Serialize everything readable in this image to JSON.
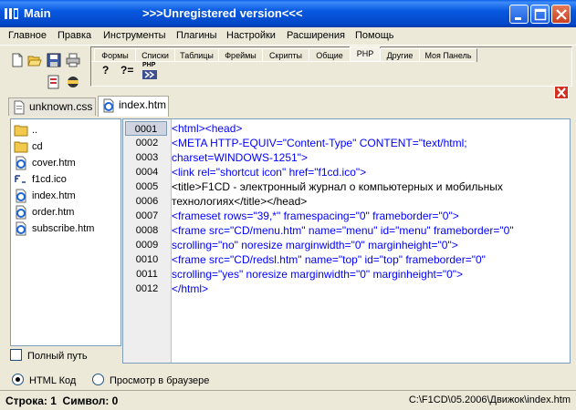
{
  "window": {
    "title": "Main",
    "subtitle": ">>>Unregistered version<<<"
  },
  "menu": [
    "Главное",
    "Правка",
    "Инструменты",
    "Плагины",
    "Настройки",
    "Расширения",
    "Помощь"
  ],
  "toolbar": {
    "icons": [
      "new-file-icon",
      "open-folder-icon",
      "save-icon",
      "print-icon",
      "preview-icon",
      "ftp-icon"
    ]
  },
  "tag_tabs": [
    "Формы",
    "Списки",
    "Таблицы",
    "Фреймы",
    "Скрипты",
    "Общие",
    "PHP",
    "Другие",
    "Моя Панель"
  ],
  "active_tag_tab": "PHP",
  "panel_buttons": [
    "?",
    "?=",
    "PHP"
  ],
  "doc_tabs": [
    {
      "label": "unknown.css",
      "active": false
    },
    {
      "label": "index.htm",
      "active": true
    }
  ],
  "files": [
    "..",
    "cd",
    "cover.htm",
    "f1cd.ico",
    "index.htm",
    "order.htm",
    "subscribe.htm"
  ],
  "full_path_label": "Полный путь",
  "line_numbers": [
    "0001",
    "0002",
    "0003",
    "0004",
    "0005",
    "0006",
    "0007",
    "0008",
    "0009",
    "0010",
    "0011",
    "0012"
  ],
  "code_lines": [
    "<html><head>",
    "<META HTTP-EQUIV=\"Content-Type\" CONTENT=\"text/html;",
    "charset=WINDOWS-1251\">",
    "<link rel=\"shortcut icon\" href=\"f1cd.ico\">",
    "<title>F1CD - электронный журнал о компьютерных и мобильных",
    "технологиях</title></head>",
    "<frameset  rows=\"39,*\" framespacing=\"0\" frameborder=\"0\">",
    "<frame src=\"CD/menu.htm\" name=\"menu\" id=\"menu\" frameborder=\"0\"",
    "scrolling=\"no\" noresize marginwidth=\"0\" marginheight=\"0\">",
    "<frame src=\"CD/redsl.htm\" name=\"top\" id=\"top\" frameborder=\"0\"",
    "scrolling=\"yes\" noresize marginwidth=\"0\" marginheight=\"0\">",
    "</html>"
  ],
  "view_modes": {
    "code": "HTML Код",
    "browser": "Просмотр в браузере",
    "selected": "code"
  },
  "status": {
    "position": "Строка: 1  Символ: 0",
    "path": "C:\\F1CD\\05.2006\\Движок\\index.htm"
  },
  "colors": {
    "titlebar": "#0758e0",
    "code_markup": "#0000ff",
    "close_panel": "#d4301f"
  }
}
